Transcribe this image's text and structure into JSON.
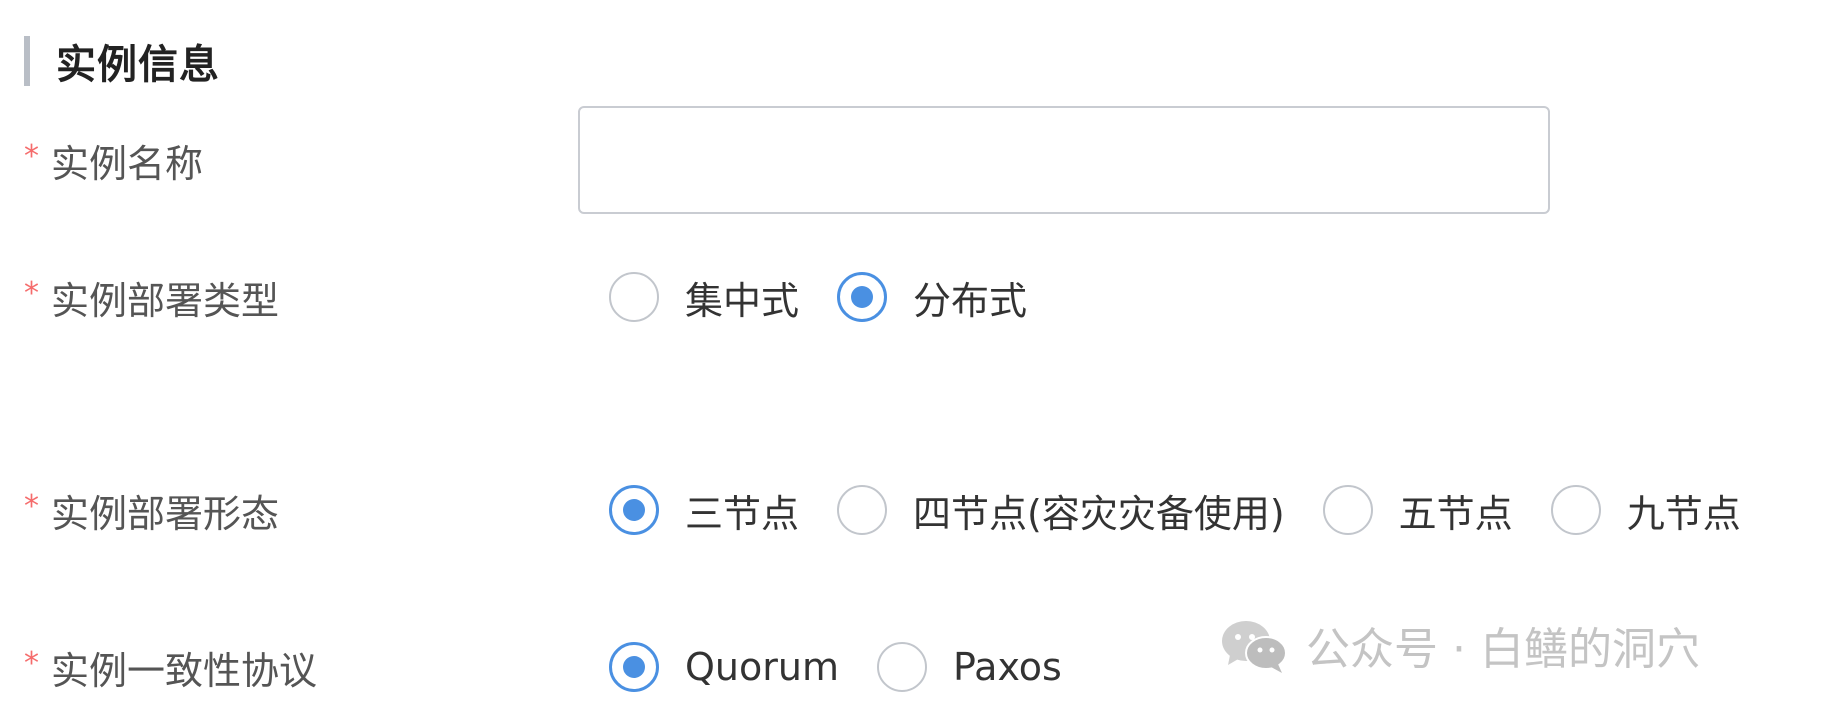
{
  "section": {
    "title": "实例信息"
  },
  "rows": [
    {
      "required": "*",
      "label": "实例名称",
      "type": "input",
      "value": "",
      "placeholder": ""
    },
    {
      "required": "*",
      "label": "实例部署类型",
      "type": "radio",
      "options": [
        {
          "label": "集中式",
          "checked": false
        },
        {
          "label": "分布式",
          "checked": true
        }
      ]
    },
    {
      "required": "*",
      "label": "实例部署形态",
      "type": "radio",
      "options": [
        {
          "label": "三节点",
          "checked": true
        },
        {
          "label": "四节点(容灾灾备使用)",
          "checked": false
        },
        {
          "label": "五节点",
          "checked": false
        },
        {
          "label": "九节点",
          "checked": false
        }
      ]
    },
    {
      "required": "*",
      "label": "实例一致性协议",
      "type": "radio",
      "options": [
        {
          "label": "Quorum",
          "checked": true
        },
        {
          "label": "Paxos",
          "checked": false
        }
      ]
    }
  ],
  "watermark": {
    "icon": "wechat-icon",
    "text": "公众号 · 白鳝的洞穴"
  },
  "colors": {
    "accent": "#4a90e2",
    "required": "#f56c6c",
    "section_bar": "#b9bec6",
    "watermark": "#c4c4c4"
  }
}
